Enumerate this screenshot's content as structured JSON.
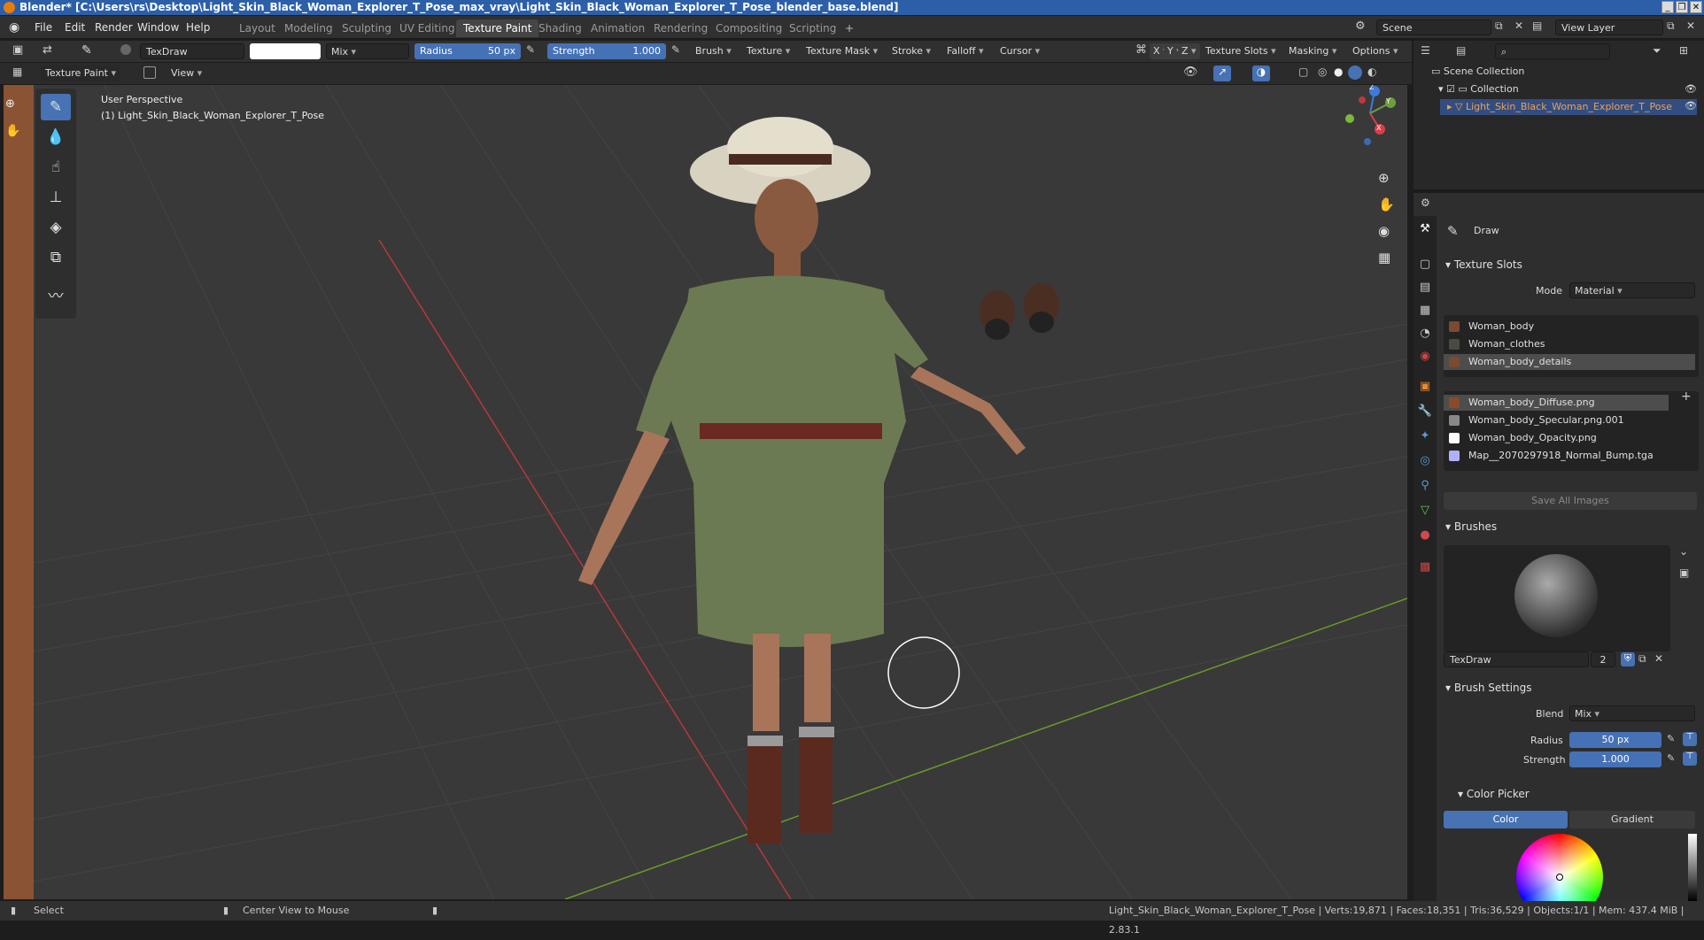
{
  "window": {
    "title": "Blender* [C:\\Users\\rs\\Desktop\\Light_Skin_Black_Woman_Explorer_T_Pose_max_vray\\Light_Skin_Black_Woman_Explorer_T_Pose_blender_base.blend]"
  },
  "menu": [
    "File",
    "Edit",
    "Render",
    "Window",
    "Help"
  ],
  "workspaces": [
    "Layout",
    "Modeling",
    "Sculpting",
    "UV Editing",
    "Texture Paint",
    "Shading",
    "Animation",
    "Rendering",
    "Compositing",
    "Scripting"
  ],
  "active_workspace": "Texture Paint",
  "scene": {
    "scene_name": "Scene",
    "view_layer": "View Layer"
  },
  "tool_header": {
    "brush_name": "TexDraw",
    "blend": "Mix",
    "radius_label": "Radius",
    "radius_value": "50 px",
    "strength_label": "Strength",
    "strength_value": "1.000",
    "menus": [
      "Brush",
      "Texture",
      "Texture Mask",
      "Stroke",
      "Falloff",
      "Cursor"
    ],
    "axes": [
      "X",
      "Y",
      "Z"
    ],
    "right_menus": [
      "Texture Slots",
      "Masking",
      "Options"
    ]
  },
  "mode_header": {
    "mode": "Texture Paint",
    "view": "View"
  },
  "viewport": {
    "perspective": "User Perspective",
    "object_label": "(1) Light_Skin_Black_Woman_Explorer_T_Pose",
    "gizmo_axes": [
      "Z",
      "Y",
      "X"
    ]
  },
  "outliner": {
    "root": "Scene Collection",
    "collection": "Collection",
    "object": "Light_Skin_Black_Woman_Explorer_T_Pose"
  },
  "properties": {
    "tool_name": "Draw",
    "texture_slots_title": "Texture Slots",
    "mode_label": "Mode",
    "mode_value": "Material",
    "materials": [
      "Woman_body",
      "Woman_clothes",
      "Woman_body_details"
    ],
    "images": [
      "Woman_body_Diffuse.png",
      "Woman_body_Specular.png.001",
      "Woman_body_Opacity.png",
      "Map__2070297918_Normal_Bump.tga"
    ],
    "save_all": "Save All Images",
    "brushes_title": "Brushes",
    "brush_name": "TexDraw",
    "brush_users": "2",
    "brush_settings_title": "Brush Settings",
    "blend_label": "Blend",
    "blend_value": "Mix",
    "radius_label": "Radius",
    "radius_value": "50 px",
    "strength_label": "Strength",
    "strength_value": "1.000",
    "color_picker_title": "Color Picker",
    "color_tab": "Color",
    "gradient_tab": "Gradient"
  },
  "status": {
    "select": "Select",
    "center": "Center View to Mouse",
    "stats": "Light_Skin_Black_Woman_Explorer_T_Pose | Verts:19,871 | Faces:18,351 | Tris:36,529 | Objects:1/1 | Mem: 437.4 MiB | 2.83.1"
  },
  "colors": {
    "accent": "#4772b3",
    "background": "#393939",
    "panel": "#2e2e2e"
  }
}
